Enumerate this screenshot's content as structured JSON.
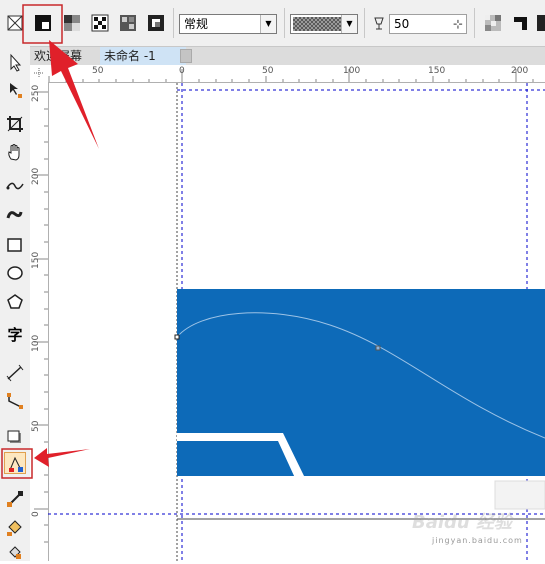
{
  "property_bar": {
    "mode_select_value": "常规",
    "transparency_value": "50",
    "stepper_symbol": "⊹"
  },
  "tabs": {
    "welcome_label": "欢迎屏幕",
    "document_label": "未命名 -1"
  },
  "ruler_top": {
    "labels": [
      "50",
      "0",
      "50",
      "100",
      "150",
      "200"
    ]
  },
  "ruler_left": {
    "labels": [
      "250",
      "200",
      "150",
      "100",
      "50",
      "0"
    ]
  },
  "watermark": {
    "url": "jingyan.baidu.com"
  },
  "colors": {
    "shape_fill": "#0d6ab8",
    "highlight": "#e0202a",
    "guide": "#0000cc"
  }
}
